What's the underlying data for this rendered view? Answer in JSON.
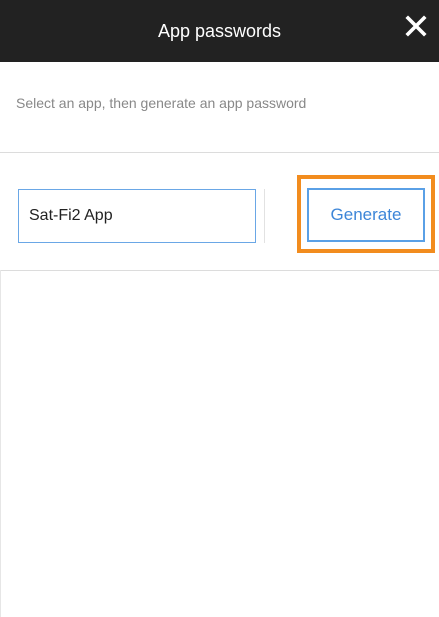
{
  "dialog": {
    "title": "App passwords",
    "subtitle": "Select an app, then generate an app password",
    "close_icon": "close-icon"
  },
  "form": {
    "app_name_value": "Sat-Fi2 App",
    "generate_label": "Generate"
  },
  "colors": {
    "header_bg": "#222222",
    "accent_blue": "#3d86d8",
    "highlight_orange": "#f28c1e"
  }
}
